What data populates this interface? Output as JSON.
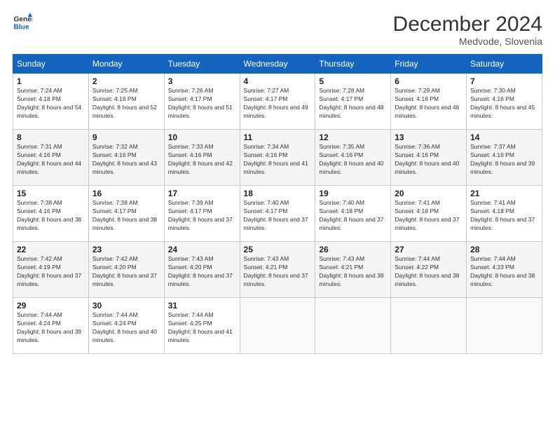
{
  "header": {
    "logo_line1": "General",
    "logo_line2": "Blue",
    "month_title": "December 2024",
    "location": "Medvode, Slovenia"
  },
  "weekdays": [
    "Sunday",
    "Monday",
    "Tuesday",
    "Wednesday",
    "Thursday",
    "Friday",
    "Saturday"
  ],
  "weeks": [
    [
      {
        "day": "1",
        "sunrise": "7:24 AM",
        "sunset": "4:18 PM",
        "daylight": "8 hours and 54 minutes."
      },
      {
        "day": "2",
        "sunrise": "7:25 AM",
        "sunset": "4:18 PM",
        "daylight": "8 hours and 52 minutes."
      },
      {
        "day": "3",
        "sunrise": "7:26 AM",
        "sunset": "4:17 PM",
        "daylight": "8 hours and 51 minutes."
      },
      {
        "day": "4",
        "sunrise": "7:27 AM",
        "sunset": "4:17 PM",
        "daylight": "8 hours and 49 minutes."
      },
      {
        "day": "5",
        "sunrise": "7:28 AM",
        "sunset": "4:17 PM",
        "daylight": "8 hours and 48 minutes."
      },
      {
        "day": "6",
        "sunrise": "7:29 AM",
        "sunset": "4:16 PM",
        "daylight": "8 hours and 46 minutes."
      },
      {
        "day": "7",
        "sunrise": "7:30 AM",
        "sunset": "4:16 PM",
        "daylight": "8 hours and 45 minutes."
      }
    ],
    [
      {
        "day": "8",
        "sunrise": "7:31 AM",
        "sunset": "4:16 PM",
        "daylight": "8 hours and 44 minutes."
      },
      {
        "day": "9",
        "sunrise": "7:32 AM",
        "sunset": "4:16 PM",
        "daylight": "8 hours and 43 minutes."
      },
      {
        "day": "10",
        "sunrise": "7:33 AM",
        "sunset": "4:16 PM",
        "daylight": "8 hours and 42 minutes."
      },
      {
        "day": "11",
        "sunrise": "7:34 AM",
        "sunset": "4:16 PM",
        "daylight": "8 hours and 41 minutes."
      },
      {
        "day": "12",
        "sunrise": "7:35 AM",
        "sunset": "4:16 PM",
        "daylight": "8 hours and 40 minutes."
      },
      {
        "day": "13",
        "sunrise": "7:36 AM",
        "sunset": "4:16 PM",
        "daylight": "8 hours and 40 minutes."
      },
      {
        "day": "14",
        "sunrise": "7:37 AM",
        "sunset": "4:16 PM",
        "daylight": "8 hours and 39 minutes."
      }
    ],
    [
      {
        "day": "15",
        "sunrise": "7:38 AM",
        "sunset": "4:16 PM",
        "daylight": "8 hours and 38 minutes."
      },
      {
        "day": "16",
        "sunrise": "7:38 AM",
        "sunset": "4:17 PM",
        "daylight": "8 hours and 38 minutes."
      },
      {
        "day": "17",
        "sunrise": "7:39 AM",
        "sunset": "4:17 PM",
        "daylight": "8 hours and 37 minutes."
      },
      {
        "day": "18",
        "sunrise": "7:40 AM",
        "sunset": "4:17 PM",
        "daylight": "8 hours and 37 minutes."
      },
      {
        "day": "19",
        "sunrise": "7:40 AM",
        "sunset": "4:18 PM",
        "daylight": "8 hours and 37 minutes."
      },
      {
        "day": "20",
        "sunrise": "7:41 AM",
        "sunset": "4:18 PM",
        "daylight": "8 hours and 37 minutes."
      },
      {
        "day": "21",
        "sunrise": "7:41 AM",
        "sunset": "4:18 PM",
        "daylight": "8 hours and 37 minutes."
      }
    ],
    [
      {
        "day": "22",
        "sunrise": "7:42 AM",
        "sunset": "4:19 PM",
        "daylight": "8 hours and 37 minutes."
      },
      {
        "day": "23",
        "sunrise": "7:42 AM",
        "sunset": "4:20 PM",
        "daylight": "8 hours and 37 minutes."
      },
      {
        "day": "24",
        "sunrise": "7:43 AM",
        "sunset": "4:20 PM",
        "daylight": "8 hours and 37 minutes."
      },
      {
        "day": "25",
        "sunrise": "7:43 AM",
        "sunset": "4:21 PM",
        "daylight": "8 hours and 37 minutes."
      },
      {
        "day": "26",
        "sunrise": "7:43 AM",
        "sunset": "4:21 PM",
        "daylight": "8 hours and 38 minutes."
      },
      {
        "day": "27",
        "sunrise": "7:44 AM",
        "sunset": "4:22 PM",
        "daylight": "8 hours and 38 minutes."
      },
      {
        "day": "28",
        "sunrise": "7:44 AM",
        "sunset": "4:23 PM",
        "daylight": "8 hours and 38 minutes."
      }
    ],
    [
      {
        "day": "29",
        "sunrise": "7:44 AM",
        "sunset": "4:24 PM",
        "daylight": "8 hours and 39 minutes."
      },
      {
        "day": "30",
        "sunrise": "7:44 AM",
        "sunset": "4:24 PM",
        "daylight": "8 hours and 40 minutes."
      },
      {
        "day": "31",
        "sunrise": "7:44 AM",
        "sunset": "4:25 PM",
        "daylight": "8 hours and 41 minutes."
      },
      null,
      null,
      null,
      null
    ]
  ],
  "labels": {
    "sunrise": "Sunrise:",
    "sunset": "Sunset:",
    "daylight": "Daylight:"
  }
}
